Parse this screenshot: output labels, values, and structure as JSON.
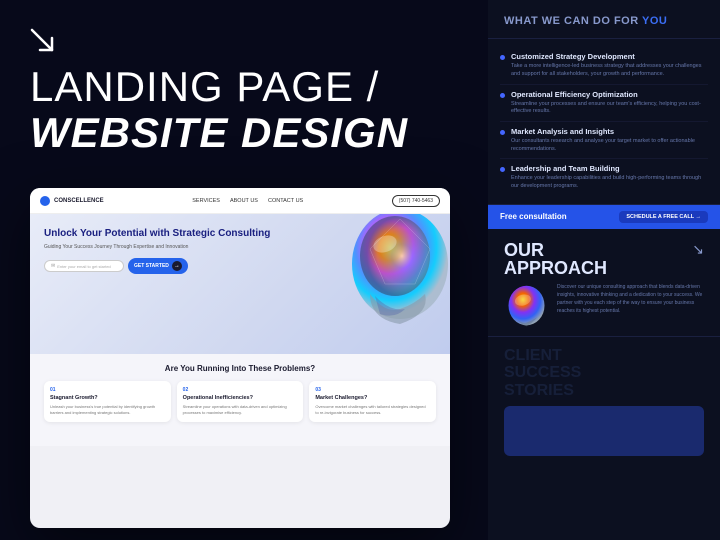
{
  "left": {
    "corner_arrow": "↘",
    "title_line1": "LANDING PAGE /",
    "title_line2_normal": "WEBSITE",
    "title_line2_accent": " DESIGN"
  },
  "mockup": {
    "nav": {
      "logo": "CONSCELLENCE",
      "links": [
        "SERVICES",
        "ABOUT US",
        "CONTACT US"
      ],
      "phone": "(507) 740-5463"
    },
    "hero": {
      "title": "Unlock Your Potential with Strategic Consulting",
      "subtitle": "Guiding Your Success Journey Through Expertise and Innovation",
      "email_placeholder": "Enter your email to get started",
      "cta": "GET STARTED"
    },
    "problems": {
      "title": "Are You Running Into These Problems?",
      "cards": [
        {
          "num": "01",
          "title": "Stagnant Growth?",
          "desc": "Unleash your business's true potential by identifying growth barriers and implementing strategic solutions."
        },
        {
          "num": "02",
          "title": "Operational Inefficiencies?",
          "desc": "Streamline your operations with data-driven and optimizing processes to maximise efficiency."
        },
        {
          "num": "03",
          "title": "Market Challenges?",
          "desc": "Overcome market challenges with tailored strategies designed to re-invigorate business for success."
        }
      ]
    }
  },
  "right": {
    "header": {
      "text": "WHAT WE CAN DO FOR ",
      "accent": "YOU"
    },
    "services": [
      {
        "title": "Customized Strategy Development",
        "desc": "Take a more intelligence-led business strategy that addresses your challenges and support for all key stakeholders, your growth and overall performance."
      },
      {
        "title": "Operational Efficiency Optimization",
        "desc": "Streamline your processes and ensure our team's efficiency, helping you cost-effective results."
      },
      {
        "title": "Market Analysis and Insights",
        "desc": "Our consultants research and analyses your target market to offer actionable recommendations."
      },
      {
        "title": "Leadership and Team Building",
        "desc": "Enhance your leadership capabilities and build high-performing teams through our team development programs."
      }
    ],
    "consultation": {
      "label": "Free consultation",
      "button": "SCHEDULE A FREE CALL →"
    },
    "approach": {
      "title": "OUR\nAPPROACH",
      "arrow": "↘",
      "text": "Discover our unique consulting approach that blends data-driven insights, innovative thinking and a dedication to your success. We partner with you each step of the way to ensure your business reaches its highest potential."
    },
    "client_success": {
      "title": "CLIENT\nSUCCESS\nSTORIES"
    }
  }
}
